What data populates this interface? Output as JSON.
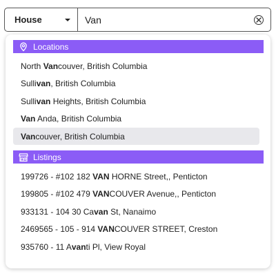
{
  "search": {
    "type_label": "House",
    "query": "Van"
  },
  "colors": {
    "section_header": "#8b5cf6",
    "active_row": "#e8e8ec"
  },
  "icons": {
    "type_select": "chevron-down-icon",
    "clear": "clear-circle-x-icon",
    "locations": "map-pin-icon",
    "listings": "storefront-icon"
  },
  "locations": {
    "title": "Locations",
    "active_index": 4,
    "items": [
      {
        "pre": "North ",
        "match": "Van",
        "post": "couver, British Columbia"
      },
      {
        "pre": "Sulli",
        "match": "van",
        "post": ", British Columbia"
      },
      {
        "pre": "Sulli",
        "match": "van",
        "post": " Heights, British Columbia"
      },
      {
        "pre": "",
        "match": "Van",
        "post": " Anda, British Columbia"
      },
      {
        "pre": "",
        "match": "Van",
        "post": "couver, British Columbia"
      }
    ]
  },
  "listings": {
    "title": "Listings",
    "items": [
      {
        "pre": "199726 - #102 182 ",
        "match": "VAN",
        "post": " HORNE Street,, Penticton"
      },
      {
        "pre": "199805 - #102 479 ",
        "match": "VAN",
        "post": "COUVER Avenue,, Penticton"
      },
      {
        "pre": "933131 - 104 30 Ca",
        "match": "van",
        "post": " St, Nanaimo"
      },
      {
        "pre": "2469565 - 105 - 914 ",
        "match": "VAN",
        "post": "COUVER STREET, Creston"
      },
      {
        "pre": "935760 - 11 A",
        "match": "van",
        "post": "ti Pl, View Royal"
      }
    ]
  }
}
